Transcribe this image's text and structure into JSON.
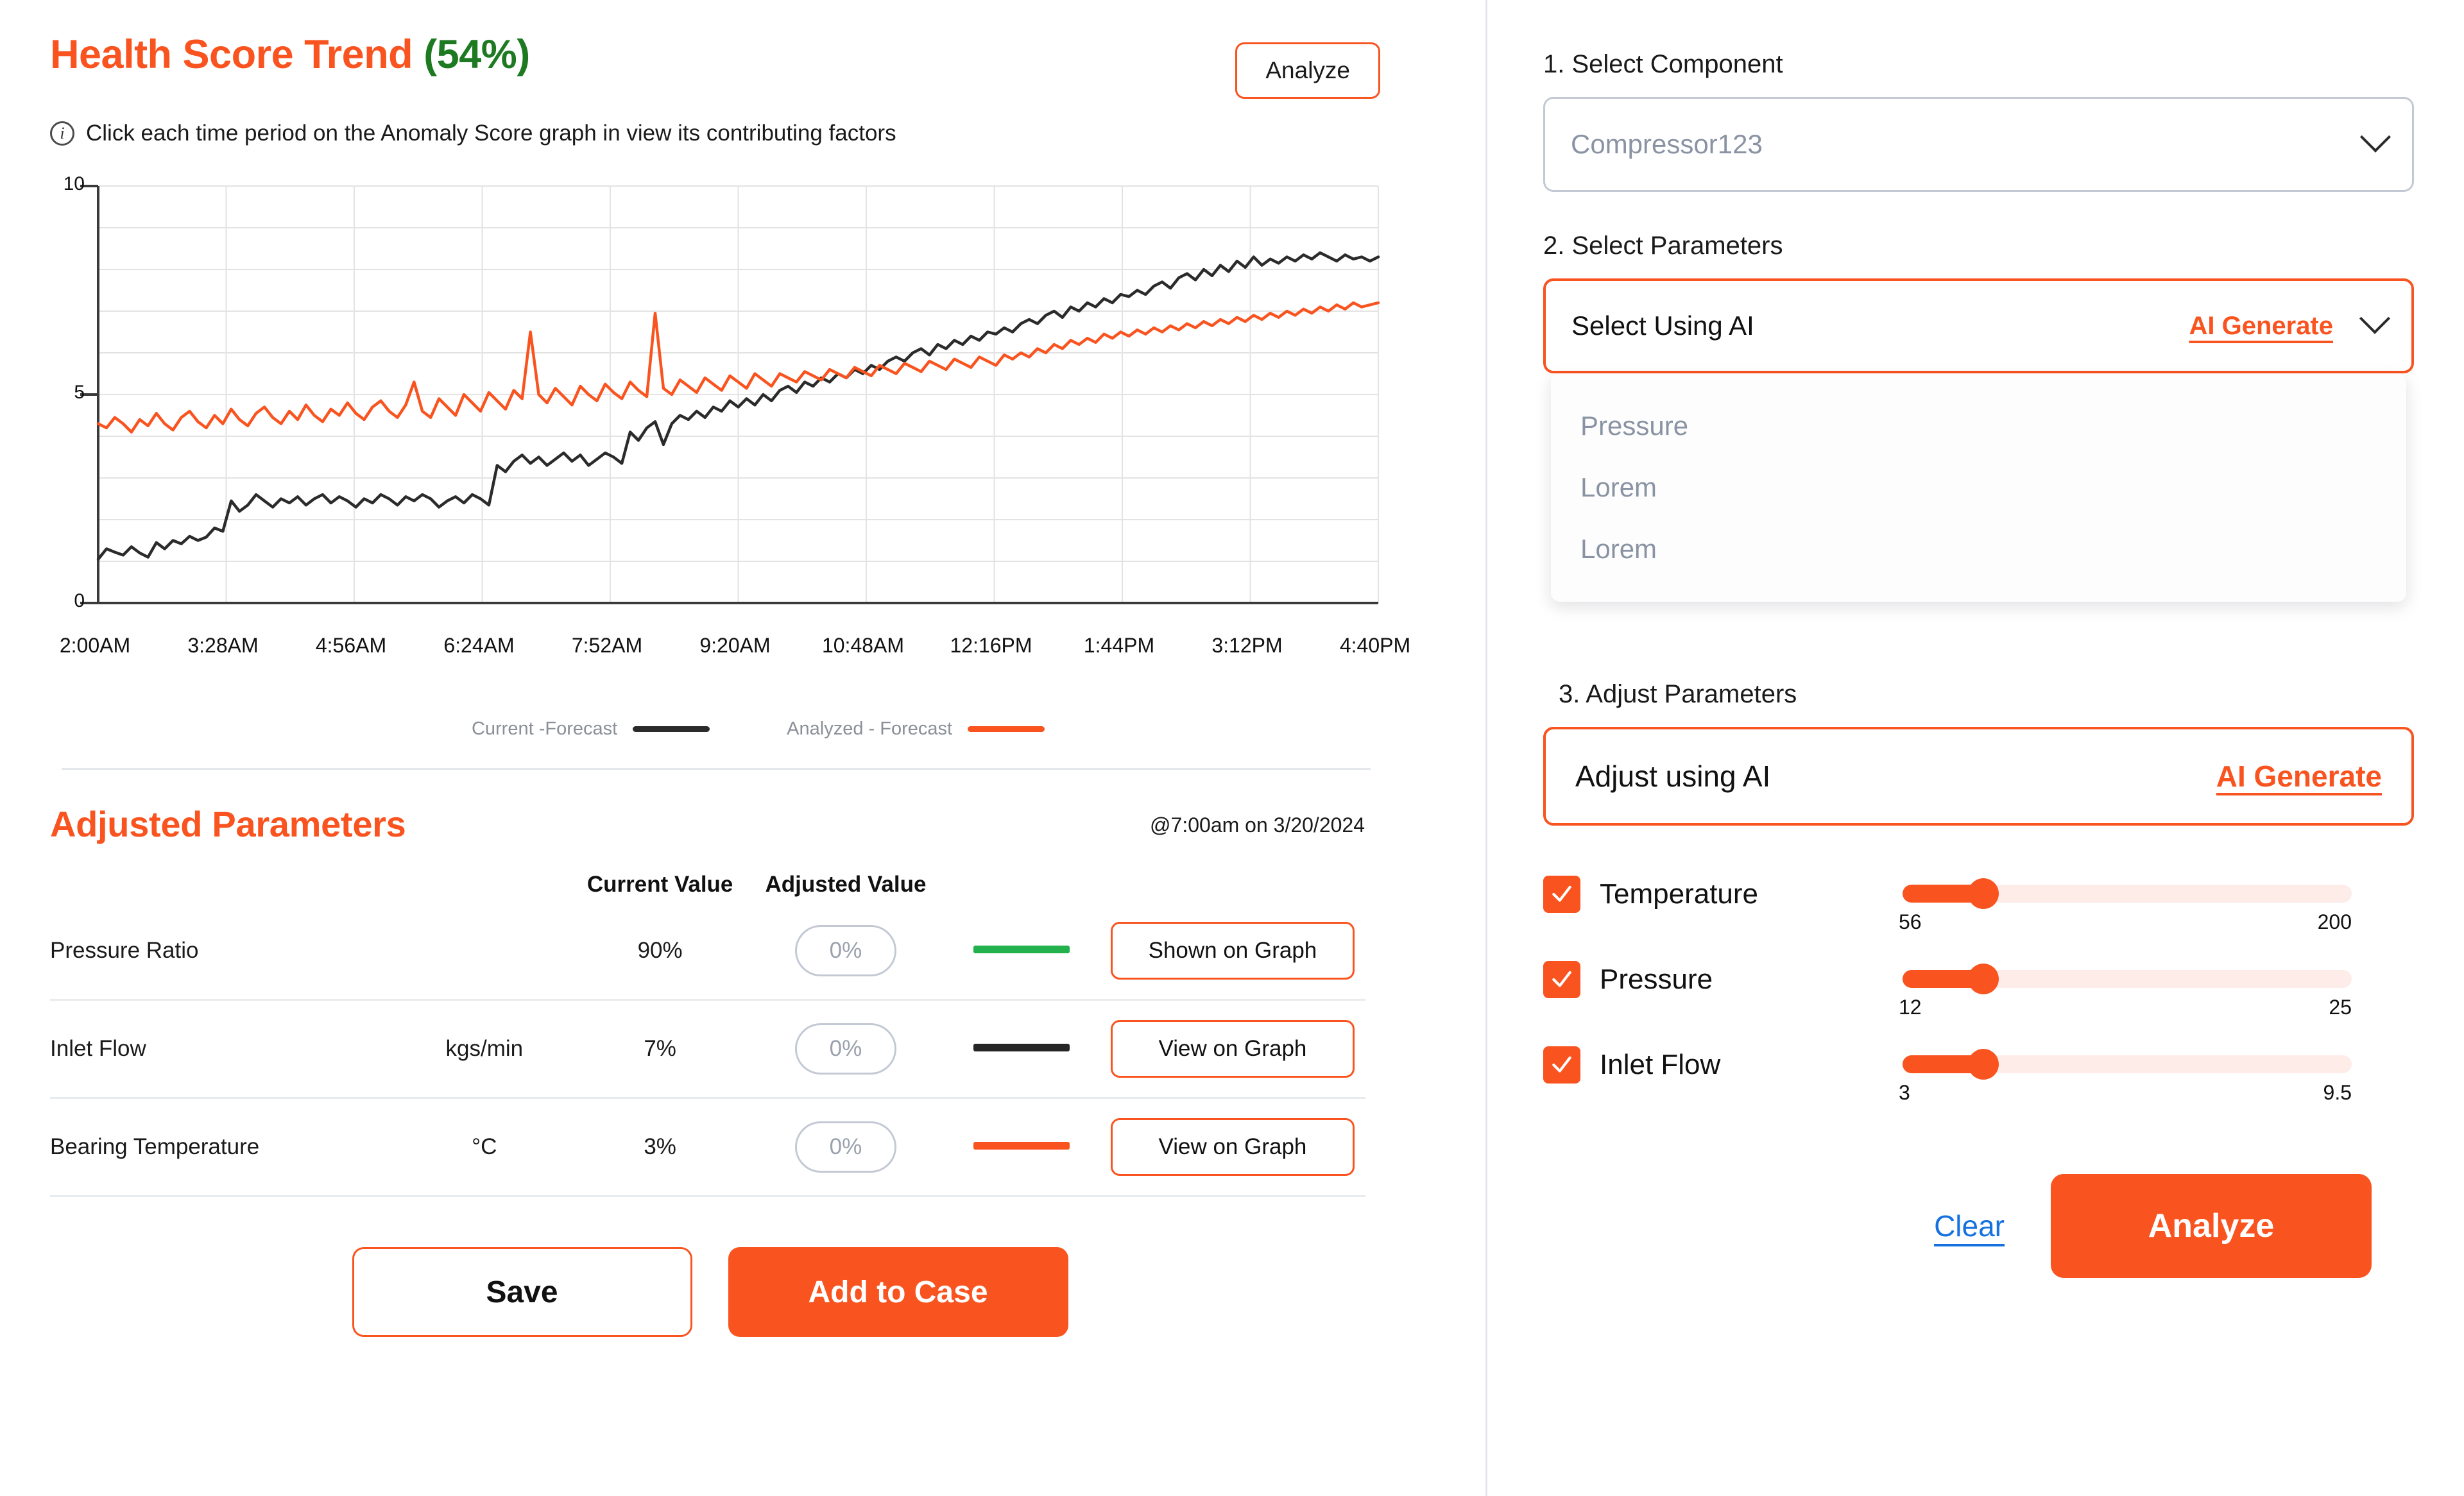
{
  "left": {
    "title_main": "Health Score Trend",
    "title_score": "(54%)",
    "analyze_top_label": "Analyze",
    "hint": "Click each time period on the Anomaly Score graph in view its contributing factors",
    "info_icon": "info-icon"
  },
  "chart_data": {
    "type": "line",
    "title": "Health Score Trend",
    "xlabel": "",
    "ylabel": "",
    "ylim": [
      0,
      10
    ],
    "yticks": [
      0,
      5,
      10
    ],
    "ytick_labels": [
      "0",
      "5",
      "10"
    ],
    "gridlines_y": [
      1,
      2,
      3,
      4,
      5,
      6,
      7,
      8,
      9,
      10
    ],
    "grid": true,
    "legend_position": "bottom-center",
    "categories": [
      "2:00AM",
      "3:28AM",
      "4:56AM",
      "6:24AM",
      "7:52AM",
      "9:20AM",
      "10:48AM",
      "12:16PM",
      "1:44PM",
      "3:12PM",
      "4:40PM"
    ],
    "xtick_labels": [
      "2:00AM",
      "3:28AM",
      "4:56AM",
      "6:24AM",
      "7:52AM",
      "9:20AM",
      "10:48AM",
      "12:16PM",
      "1:44PM",
      "3:12PM",
      "4:40PM"
    ],
    "series": [
      {
        "name": "Current -Forecast",
        "color": "#2b2b2b",
        "values": [
          1.05,
          1.3,
          1.22,
          1.15,
          1.35,
          1.2,
          1.1,
          1.45,
          1.3,
          1.5,
          1.42,
          1.6,
          1.5,
          1.58,
          1.8,
          1.72,
          2.45,
          2.2,
          2.35,
          2.6,
          2.45,
          2.3,
          2.5,
          2.4,
          2.55,
          2.35,
          2.5,
          2.6,
          2.4,
          2.55,
          2.45,
          2.3,
          2.5,
          2.4,
          2.6,
          2.5,
          2.35,
          2.55,
          2.45,
          2.6,
          2.5,
          2.3,
          2.45,
          2.55,
          2.4,
          2.6,
          2.5,
          2.35,
          3.3,
          3.15,
          3.4,
          3.55,
          3.35,
          3.5,
          3.3,
          3.45,
          3.6,
          3.4,
          3.55,
          3.3,
          3.45,
          3.6,
          3.5,
          3.35,
          4.1,
          3.9,
          4.2,
          4.35,
          3.8,
          4.3,
          4.5,
          4.4,
          4.6,
          4.45,
          4.7,
          4.6,
          4.85,
          4.7,
          4.9,
          4.75,
          5.0,
          4.85,
          5.1,
          5.2,
          5.05,
          5.3,
          5.2,
          5.4,
          5.3,
          5.5,
          5.4,
          5.6,
          5.5,
          5.7,
          5.6,
          5.8,
          5.9,
          5.8,
          6.0,
          6.1,
          5.95,
          6.2,
          6.1,
          6.3,
          6.2,
          6.4,
          6.3,
          6.5,
          6.45,
          6.6,
          6.5,
          6.7,
          6.8,
          6.7,
          6.9,
          7.0,
          6.85,
          7.1,
          7.0,
          7.2,
          7.1,
          7.3,
          7.2,
          7.4,
          7.35,
          7.5,
          7.4,
          7.6,
          7.7,
          7.55,
          7.8,
          7.9,
          7.75,
          8.0,
          7.85,
          8.1,
          7.95,
          8.2,
          8.05,
          8.3,
          8.1,
          8.25,
          8.15,
          8.3,
          8.2,
          8.35,
          8.25,
          8.4,
          8.3,
          8.2,
          8.35,
          8.25,
          8.3,
          8.2,
          8.3
        ]
      },
      {
        "name": "Analyzed - Forecast",
        "color": "#f95420",
        "values": [
          4.3,
          4.2,
          4.45,
          4.3,
          4.1,
          4.4,
          4.25,
          4.55,
          4.3,
          4.15,
          4.45,
          4.6,
          4.35,
          4.2,
          4.5,
          4.3,
          4.65,
          4.4,
          4.25,
          4.55,
          4.7,
          4.45,
          4.3,
          4.6,
          4.4,
          4.75,
          4.5,
          4.35,
          4.65,
          4.5,
          4.8,
          4.55,
          4.4,
          4.7,
          4.85,
          4.6,
          4.45,
          4.75,
          5.3,
          4.6,
          4.45,
          4.9,
          4.7,
          4.5,
          5.0,
          4.8,
          4.6,
          5.05,
          4.85,
          4.65,
          5.1,
          4.9,
          6.5,
          5.0,
          4.8,
          5.15,
          4.95,
          4.75,
          5.2,
          5.0,
          4.85,
          5.25,
          5.05,
          4.9,
          5.3,
          5.1,
          4.95,
          6.95,
          5.15,
          5.0,
          5.35,
          5.2,
          5.05,
          5.4,
          5.25,
          5.1,
          5.45,
          5.3,
          5.15,
          5.5,
          5.35,
          5.2,
          5.5,
          5.4,
          5.3,
          5.55,
          5.45,
          5.35,
          5.6,
          5.5,
          5.4,
          5.65,
          5.55,
          5.45,
          5.7,
          5.6,
          5.5,
          5.75,
          5.65,
          5.55,
          5.8,
          5.7,
          5.6,
          5.85,
          5.75,
          5.65,
          5.9,
          5.8,
          5.7,
          5.95,
          5.85,
          6.0,
          5.9,
          6.1,
          6.0,
          6.2,
          6.1,
          6.3,
          6.2,
          6.35,
          6.25,
          6.45,
          6.35,
          6.5,
          6.4,
          6.55,
          6.45,
          6.6,
          6.5,
          6.65,
          6.55,
          6.7,
          6.6,
          6.75,
          6.65,
          6.8,
          6.7,
          6.85,
          6.75,
          6.9,
          6.8,
          6.95,
          6.85,
          7.0,
          6.9,
          7.05,
          6.95,
          7.1,
          7.0,
          7.15,
          7.05,
          7.2,
          7.1,
          7.15,
          7.2
        ]
      }
    ]
  },
  "adjusted": {
    "section_title": "Adjusted Parameters",
    "timestamp": "@7:00am on 3/20/2024",
    "columns": [
      "",
      "",
      "Current Value",
      "Adjusted Value",
      "",
      ""
    ],
    "header_current": "Current Value",
    "header_adjusted": "Adjusted Value",
    "rows": [
      {
        "name": "Pressure Ratio",
        "unit": "",
        "current": "90%",
        "adjusted_placeholder": "0%",
        "adjusted_value": "",
        "line_color": "#22b14c",
        "action_label": "Shown on Graph"
      },
      {
        "name": "Inlet Flow",
        "unit": "kgs/min",
        "current": "7%",
        "adjusted_placeholder": "0%",
        "adjusted_value": "",
        "line_color": "#262626",
        "action_label": "View on Graph"
      },
      {
        "name": "Bearing Temperature",
        "unit": "°C",
        "current": "3%",
        "adjusted_placeholder": "0%",
        "adjusted_value": "",
        "line_color": "#f95420",
        "action_label": "View on Graph"
      }
    ],
    "save_label": "Save",
    "add_case_label": "Add to Case"
  },
  "right": {
    "step1_label": "1. Select Component",
    "component_value": "Compressor123",
    "step2_label": "2. Select Parameters",
    "parameters_value": "Select Using AI",
    "ai_generate_label": "AI Generate",
    "dropdown_options": [
      "Pressure",
      "Lorem",
      "Lorem"
    ],
    "step3_label": "3. Adjust Parameters",
    "adjust_ai_value": "Adjust using AI",
    "adjust_ai_generate_label": "AI Generate",
    "sliders": [
      {
        "label": "Temperature",
        "checked": true,
        "min": "56",
        "max": "200",
        "fill_pct": 18
      },
      {
        "label": "Pressure",
        "checked": true,
        "min": "12",
        "max": "25",
        "fill_pct": 18
      },
      {
        "label": "Inlet Flow",
        "checked": true,
        "min": "3",
        "max": "9.5",
        "fill_pct": 18
      }
    ],
    "clear_label": "Clear",
    "analyze_label": "Analyze"
  },
  "colors": {
    "accent": "#f95420",
    "score_green": "#1d7a21",
    "link_blue": "#1671e0",
    "line_black": "#262626",
    "line_green": "#22b14c"
  }
}
